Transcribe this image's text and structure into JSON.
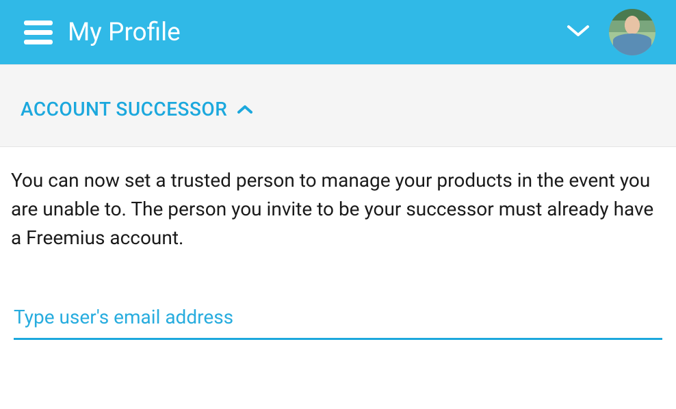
{
  "header": {
    "title": "My Profile"
  },
  "section": {
    "title": "ACCOUNT SUCCESSOR",
    "description": "You can now set a trusted person to manage your products in the event you are unable to. The person you invite to be your successor must already have a Freemius account."
  },
  "form": {
    "email_placeholder": "Type user's email address",
    "email_value": ""
  },
  "colors": {
    "primary": "#30b9e7",
    "accent": "#1ca8dd"
  }
}
